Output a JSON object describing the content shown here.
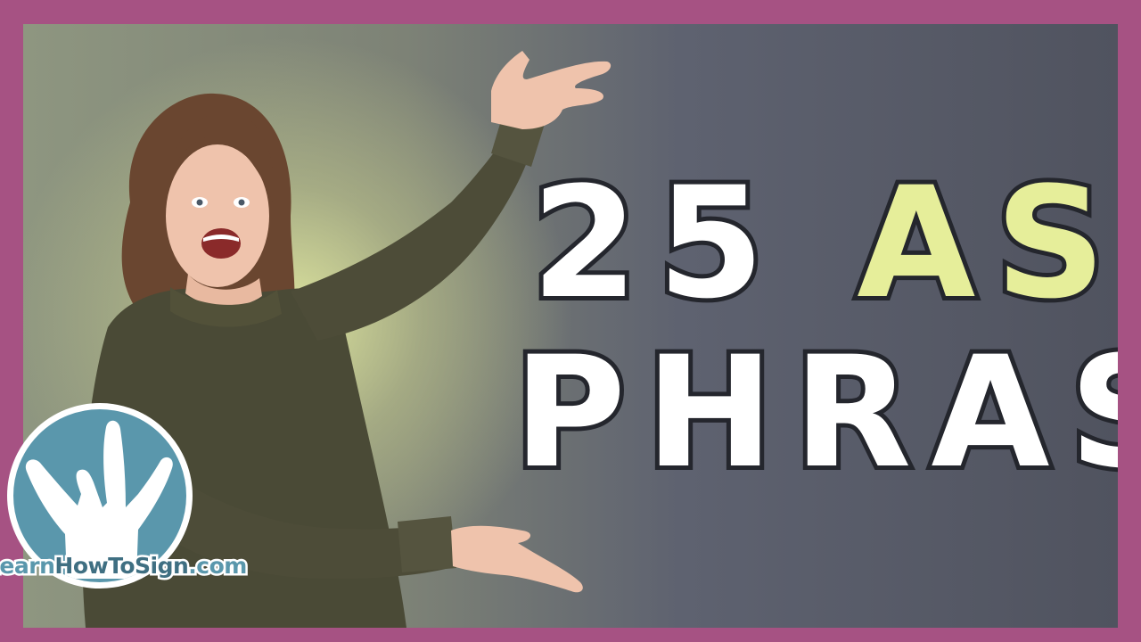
{
  "thumbnail": {
    "title_line1_number": "25",
    "title_line1_accent": "ASL",
    "title_line2": "PHRASES",
    "logo_text_a": "Learn",
    "logo_text_b": "HowToSign",
    "logo_text_c": ".com"
  },
  "colors": {
    "frame": "#a65283",
    "accent_text": "#e6ee9a",
    "logo_blue": "#5a97ac",
    "sweater": "#4a4a36"
  },
  "icons": {
    "logo": "ily-hand-icon"
  }
}
